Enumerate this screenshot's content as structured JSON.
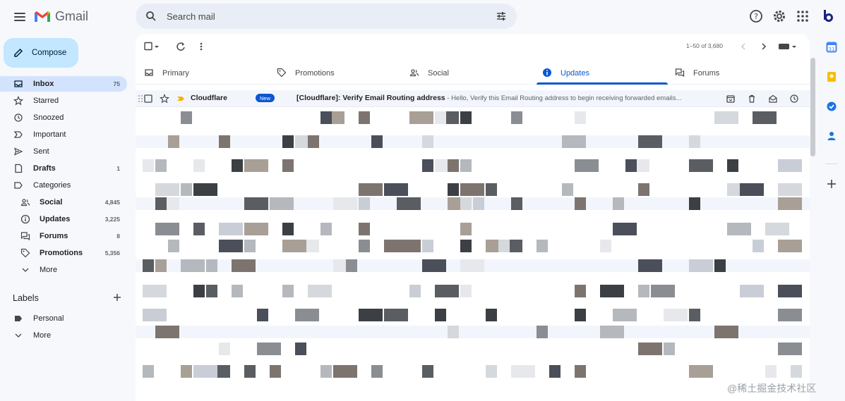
{
  "app": {
    "name": "Gmail"
  },
  "search": {
    "placeholder": "Search mail"
  },
  "compose": {
    "label": "Compose"
  },
  "nav": [
    {
      "label": "Inbox",
      "count": "75",
      "icon": "inbox-icon",
      "active": true
    },
    {
      "label": "Starred",
      "count": "",
      "icon": "star-icon"
    },
    {
      "label": "Snoozed",
      "count": "",
      "icon": "clock-icon"
    },
    {
      "label": "Important",
      "count": "",
      "icon": "important-icon"
    },
    {
      "label": "Sent",
      "count": "",
      "icon": "send-icon"
    },
    {
      "label": "Drafts",
      "count": "1",
      "icon": "draft-icon",
      "bold": true
    },
    {
      "label": "Categories",
      "count": "",
      "icon": "label-outline-icon"
    },
    {
      "label": "Social",
      "count": "4,845",
      "icon": "people-icon",
      "sub": true,
      "bold": true
    },
    {
      "label": "Updates",
      "count": "3,225",
      "icon": "info-icon",
      "sub": true,
      "bold": true
    },
    {
      "label": "Forums",
      "count": "8",
      "icon": "forum-icon",
      "sub": true,
      "bold": true
    },
    {
      "label": "Promotions",
      "count": "5,356",
      "icon": "tag-icon",
      "sub": true,
      "bold": true
    },
    {
      "label": "More",
      "count": "",
      "icon": "chevron-down-icon",
      "sub": true
    }
  ],
  "labels": {
    "heading": "Labels",
    "items": [
      {
        "label": "Personal",
        "icon": "label-filled-icon"
      },
      {
        "label": "More",
        "icon": "chevron-down-icon"
      }
    ]
  },
  "pager": {
    "text": "1–50 of 3,680"
  },
  "tabs": [
    {
      "label": "Primary",
      "icon": "inbox-icon"
    },
    {
      "label": "Promotions",
      "icon": "tag-icon"
    },
    {
      "label": "Social",
      "icon": "people-icon"
    },
    {
      "label": "Updates",
      "icon": "info-icon",
      "active": true
    },
    {
      "label": "Forums",
      "icon": "forum-icon"
    }
  ],
  "email": {
    "sender": "Cloudflare",
    "badge": "New",
    "subject": "[Cloudflare]: Verify Email Routing address",
    "snippet": " - Hello, Verify this Email Routing address to begin receiving forwarded emails..."
  },
  "watermark": "@稀土掘金技术社区",
  "colors": {
    "accent": "#0b57d0",
    "compose_bg": "#c2e7ff",
    "active_nav": "#d3e3fd"
  }
}
